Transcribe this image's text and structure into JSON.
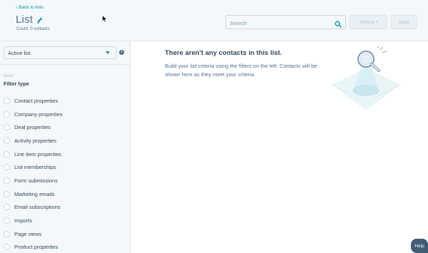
{
  "header": {
    "back_link": "Back to lists",
    "title": "List",
    "count": "Count: 0 contacts",
    "search_placeholder": "Search",
    "actions_label": "Actions",
    "save_label": "Save"
  },
  "sidebar": {
    "list_type": "Active list",
    "back_label": "Back",
    "filter_title": "Filter type",
    "filters": [
      "Contact properties",
      "Company properties",
      "Deal properties",
      "Activity properties",
      "Line item properties",
      "List memberships",
      "Form submissions",
      "Marketing emails",
      "Email subscriptions",
      "Imports",
      "Page views",
      "Product properties"
    ]
  },
  "main": {
    "empty_title": "There aren't any contacts in this list.",
    "empty_description": "Build your list criteria using the filters on the left. Contacts will be shown here as they meet your criteria."
  },
  "help_label": "Help",
  "colors": {
    "accent": "#0091ae",
    "text": "#33475b",
    "muted": "#516f90",
    "border": "#dfe3eb",
    "panel": "#f5f8fa"
  }
}
